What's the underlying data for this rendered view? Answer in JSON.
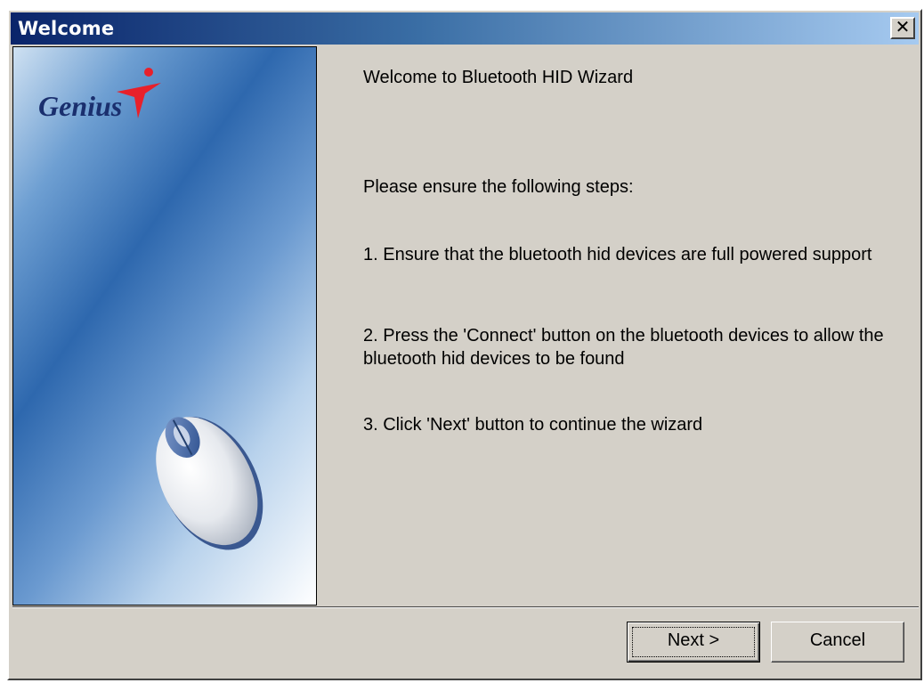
{
  "window": {
    "title": "Welcome",
    "close_glyph": "✕"
  },
  "side_panel": {
    "logo_text": "Genius",
    "logo_icon": "genius-star-figure-icon",
    "image": "computer-mouse-icon",
    "colors": {
      "gradient_dark": "#2e68ae",
      "gradient_light": "#ffffff",
      "logo_red": "#e8202a"
    }
  },
  "content": {
    "heading": "Welcome to Bluetooth HID Wizard",
    "intro": "Please ensure the following steps:",
    "step1": "1. Ensure that the bluetooth hid devices are full powered support",
    "step2": "2. Press the 'Connect' button on the bluetooth devices to allow the bluetooth hid devices to be found",
    "step3": "3. Click 'Next' button to continue the wizard"
  },
  "buttons": {
    "next_label": "Next >",
    "cancel_label": "Cancel"
  },
  "theme": {
    "face": "#d4d0c8",
    "title_start": "#0a246a",
    "title_end": "#a6caf0"
  }
}
